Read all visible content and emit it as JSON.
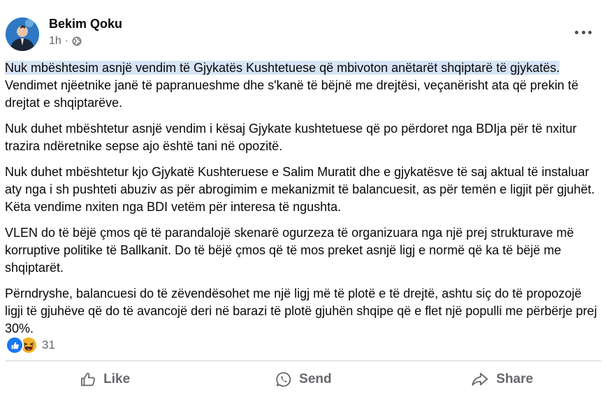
{
  "post": {
    "author": "Bekim Qoku",
    "time": "1h",
    "separator": "·",
    "privacy_icon": "globe-icon",
    "more_icon": "more-horizontal-icon",
    "paragraphs": [
      {
        "highlighted": "Nuk mbështesim asnjë vendim të Gjykatës Kushtetuese që mbivoton anëtarët shqiptarë të gjykatës.",
        "text": " Vendimet njëetnike janë të papranueshme dhe s'kanë të bëjnë me drejtësi, veçanërisht ata që prekin të drejtat e shqiptarëve."
      },
      {
        "text": "Nuk duhet mbështetur asnjë vendim i kësaj Gjykate kushtetuese që po përdoret nga BDIja për të nxitur trazira ndëretnike sepse ajo është tani në opozitë."
      },
      {
        "text": "Nuk duhet mbështetur kjo Gjykatë Kushteruese e Salim Muratit dhe e gjykatësve të saj aktual të instaluar aty nga i sh pushteti abuziv as për abrogimim e mekanizmit të balancuesit, as për temën e ligjit për gjuhët. Këta vendime nxiten nga BDI vetëm për interesa të ngushta."
      },
      {
        "text": "VLEN do të bëjë çmos që të parandalojë skenarë ogurzeza të organizuara nga një prej strukturave më korruptive politike të Ballkanit. Do të bëjë çmos që të mos preket asnjë ligj e normë që ka të bëjë me shqiptarët."
      },
      {
        "text": "Përndryshe, balancuesi do të zëvendësohet me një ligj më të plotë e të drejtë, ashtu siç do të propozojë ligji të gjuhëve që do të avancojë deri në barazi të plotë gjuhën shqipe që e flet një populli me përbërje prej 30%."
      }
    ],
    "reactions": {
      "icons": [
        "like-reaction-icon",
        "haha-reaction-icon"
      ],
      "count": "31"
    },
    "actions": {
      "like_label": "Like",
      "send_label": "Send",
      "share_label": "Share"
    }
  },
  "colors": {
    "text": "#080809",
    "secondary": "#65676b",
    "highlight": "#d7e4f6",
    "like_blue": "#1877f2",
    "haha_yellow": "#f7b125",
    "divider": "#ced0d4"
  }
}
